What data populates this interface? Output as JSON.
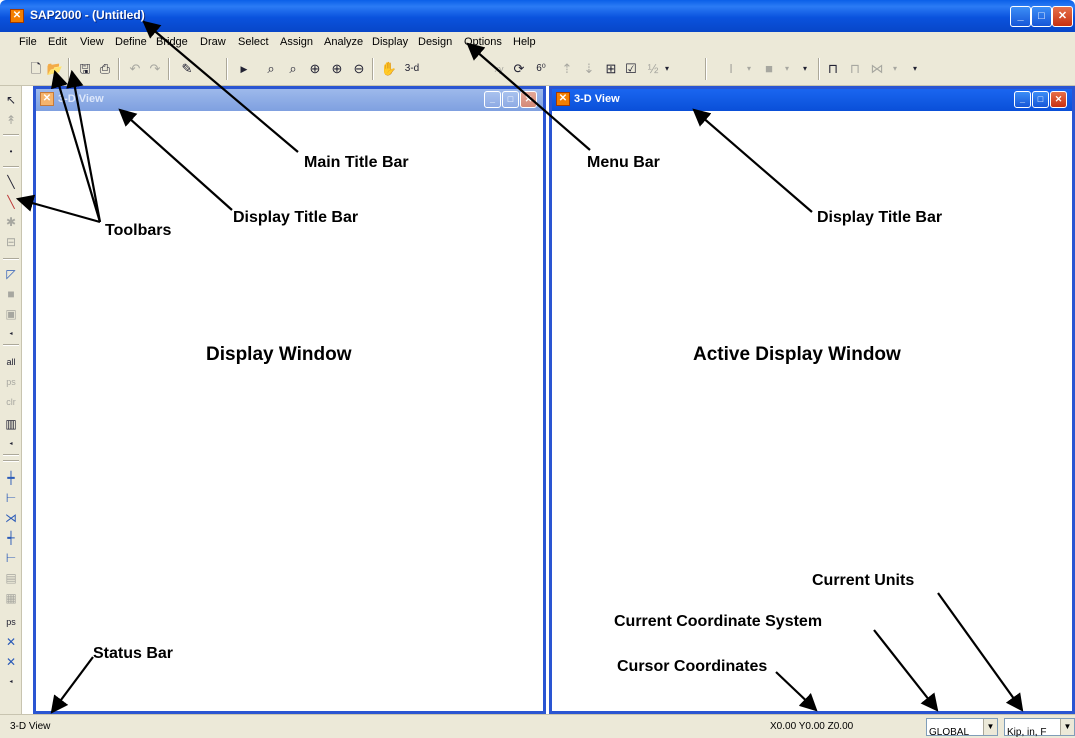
{
  "window": {
    "title": "SAP2000 - (Untitled)",
    "app_icon": "sap-logo-icon"
  },
  "menu": [
    "File",
    "Edit",
    "View",
    "Define",
    "Bridge",
    "Draw",
    "Select",
    "Assign",
    "Analyze",
    "Display",
    "Design",
    "Options",
    "Help"
  ],
  "toolbar": {
    "view_3d_label": "3-d"
  },
  "panes": {
    "left": {
      "title": "3-D View",
      "state": "inactive"
    },
    "right": {
      "title": "3-D View",
      "state": "active"
    }
  },
  "status": {
    "view": "3-D View",
    "coords": "X0.00  Y0.00  Z0.00",
    "coord_system": "GLOBAL",
    "units": "Kip, in, F"
  },
  "annotations": {
    "main_title_bar": "Main Title Bar",
    "menu_bar": "Menu Bar",
    "display_title_bar_left": "Display Title Bar",
    "display_title_bar_right": "Display Title Bar",
    "toolbars": "Toolbars",
    "display_window": "Display Window",
    "active_display_window": "Active Display Window",
    "current_units": "Current Units",
    "current_coordinate_system": "Current Coordinate System",
    "cursor_coordinates": "Cursor Coordinates",
    "status_bar": "Status Bar"
  },
  "colors": {
    "title_bar": "#0a52dd",
    "chrome": "#ece9d8",
    "pane_border": "#2a55d2",
    "arrow": "#000000"
  }
}
